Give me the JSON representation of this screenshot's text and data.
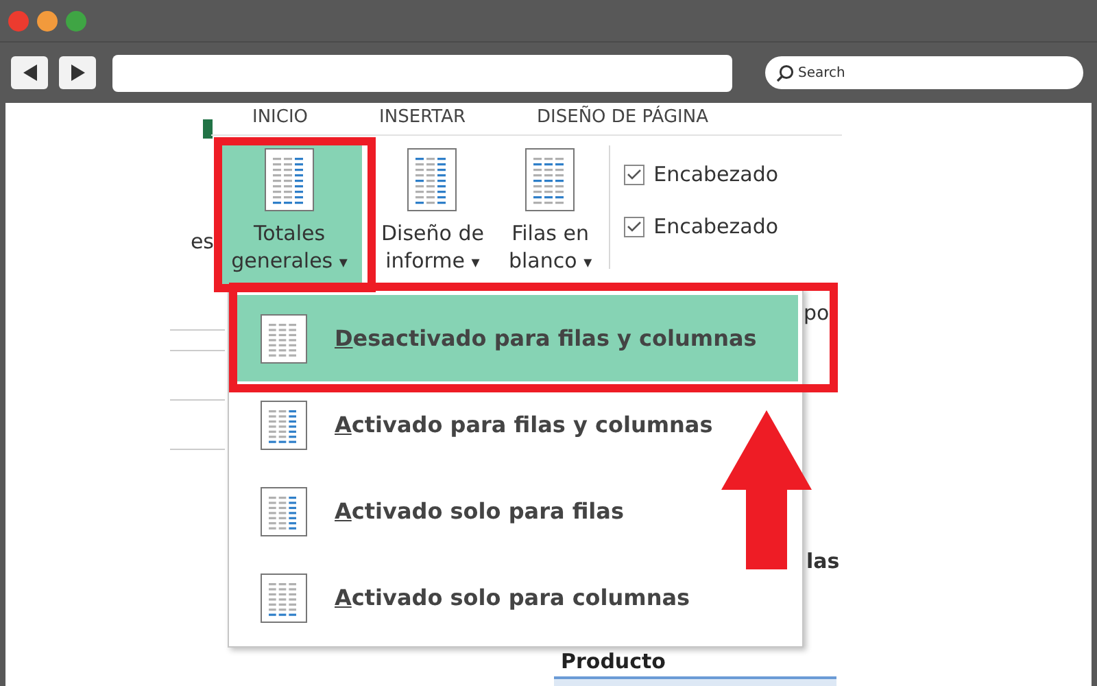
{
  "browser": {
    "search": {
      "placeholder": "Search"
    }
  },
  "ribbon_tabs": [
    {
      "label": "INICIO"
    },
    {
      "label": "INSERTAR"
    },
    {
      "label": "DISEÑO DE PÁGINA"
    }
  ],
  "ribbon": {
    "cut_label": "es",
    "buttons": [
      {
        "lines": [
          "Totales",
          "generales"
        ],
        "caret": "▾",
        "selected": true
      },
      {
        "lines": [
          "Diseño de",
          "informe"
        ],
        "caret": "▾",
        "selected": false
      },
      {
        "lines": [
          "Filas en",
          "blanco"
        ],
        "caret": "▾",
        "selected": false
      }
    ],
    "checkboxes": [
      {
        "label": "Encabezado",
        "checked": true
      },
      {
        "label": "Encabezado",
        "checked": true
      }
    ]
  },
  "menu": {
    "items": [
      {
        "label": "Desactivado para filas y columnas",
        "selected": true
      },
      {
        "label": "Activado para filas y columnas",
        "selected": false
      },
      {
        "label": "Activado solo para filas",
        "selected": false
      },
      {
        "label": "Activado solo para columnas",
        "selected": false
      }
    ]
  },
  "sheet": {
    "fragments": [
      "po",
      "las"
    ],
    "header": "Producto"
  }
}
